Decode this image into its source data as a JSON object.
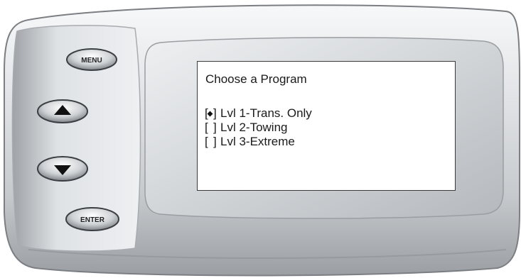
{
  "device": {
    "buttons": {
      "menu_label": "MENU",
      "enter_label": "ENTER"
    }
  },
  "screen": {
    "title": "Choose a Program",
    "options": [
      {
        "label": "Lvl 1-Trans. Only",
        "selected": true
      },
      {
        "label": "Lvl 2-Towing",
        "selected": false
      },
      {
        "label": "Lvl 3-Extreme",
        "selected": false
      }
    ]
  },
  "colors": {
    "device_body": "#d9dbde",
    "screen_bg": "#ffffff",
    "screen_border": "#3a3a3a"
  }
}
